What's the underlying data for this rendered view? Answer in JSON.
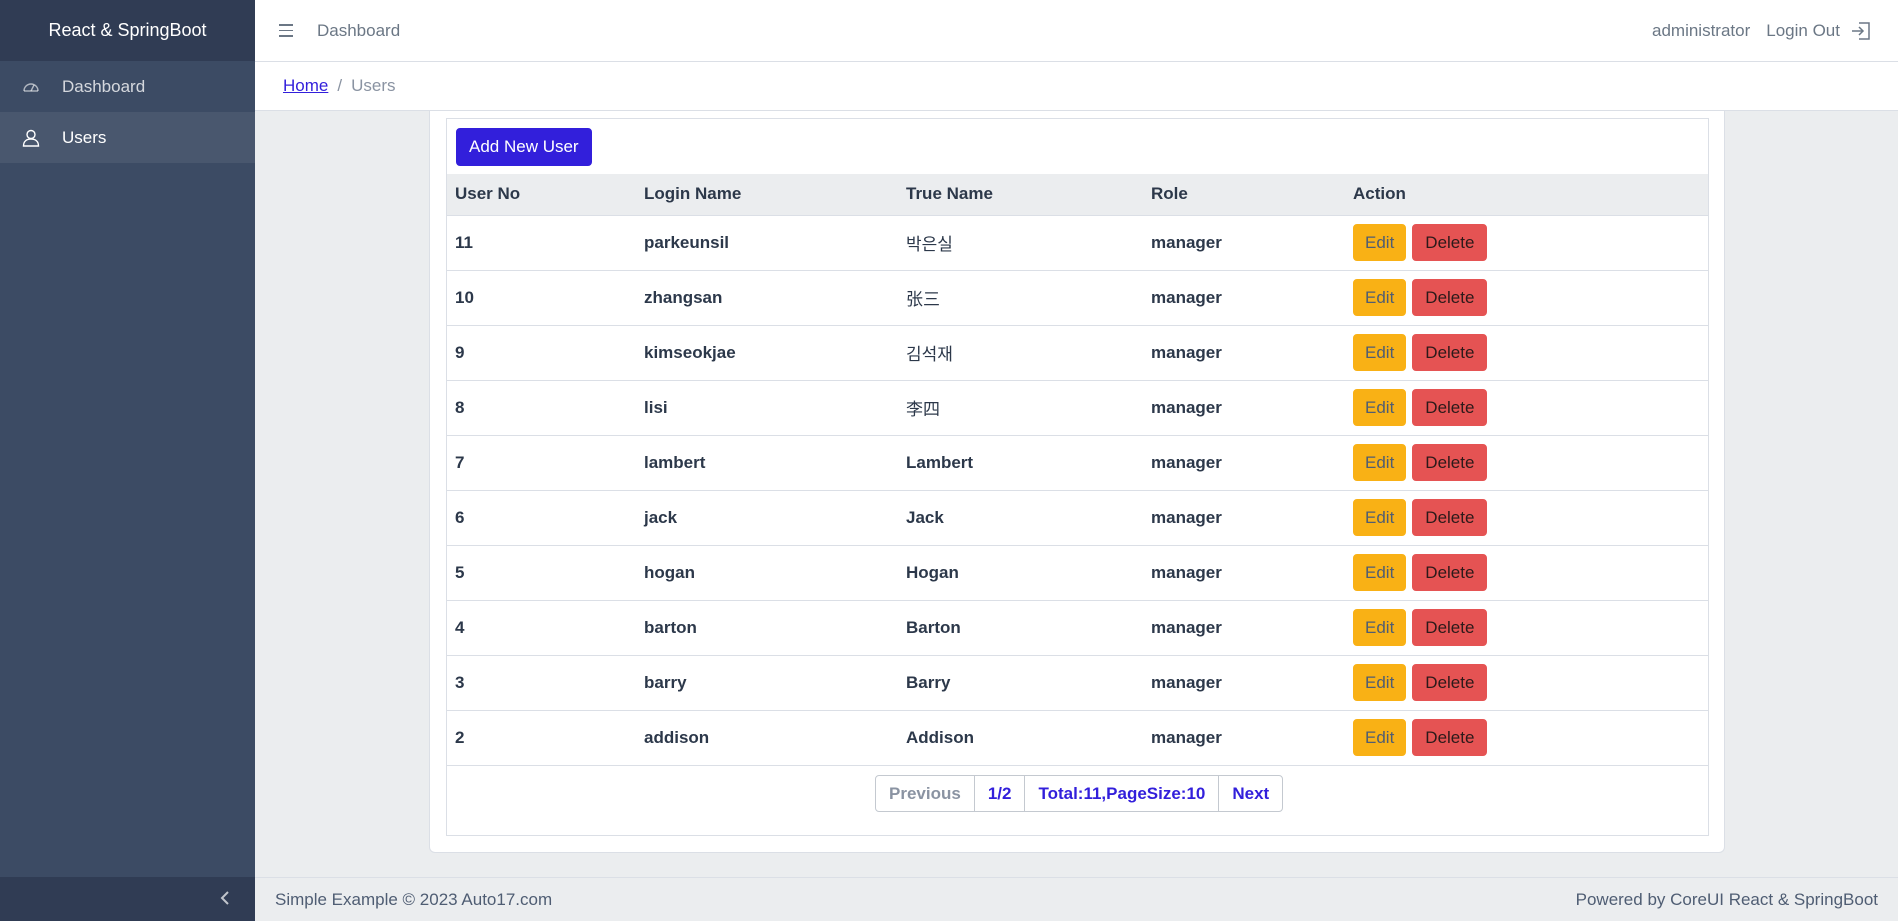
{
  "sidebar": {
    "brand": "React & SpringBoot",
    "items": [
      {
        "label": "Dashboard",
        "icon": "speedometer-icon"
      },
      {
        "label": "Users",
        "icon": "user-icon"
      }
    ],
    "toggler_icon": "chevron-left-icon"
  },
  "header": {
    "title": "Dashboard",
    "user": "administrator",
    "logout_label": "Login Out"
  },
  "breadcrumb": {
    "home": "Home",
    "separator": "/",
    "current": "Users"
  },
  "main": {
    "add_button": "Add New User",
    "columns": [
      "User No",
      "Login Name",
      "True Name",
      "Role",
      "Action"
    ],
    "rows": [
      {
        "no": "11",
        "login": "parkeunsil",
        "name": "박은실",
        "role": "manager"
      },
      {
        "no": "10",
        "login": "zhangsan",
        "name": "张三",
        "role": "manager"
      },
      {
        "no": "9",
        "login": "kimseokjae",
        "name": "김석재",
        "role": "manager"
      },
      {
        "no": "8",
        "login": "lisi",
        "name": "李四",
        "role": "manager"
      },
      {
        "no": "7",
        "login": "lambert",
        "name": "Lambert",
        "role": "manager"
      },
      {
        "no": "6",
        "login": "jack",
        "name": "Jack",
        "role": "manager"
      },
      {
        "no": "5",
        "login": "hogan",
        "name": "Hogan",
        "role": "manager"
      },
      {
        "no": "4",
        "login": "barton",
        "name": "Barton",
        "role": "manager"
      },
      {
        "no": "3",
        "login": "barry",
        "name": "Barry",
        "role": "manager"
      },
      {
        "no": "2",
        "login": "addison",
        "name": "Addison",
        "role": "manager"
      }
    ],
    "edit_label": "Edit",
    "delete_label": "Delete"
  },
  "pagination": {
    "previous": "Previous",
    "page": "1/2",
    "info": "Total:11,PageSize:10",
    "next": "Next"
  },
  "footer": {
    "left": "Simple Example © 2023 Auto17.com",
    "right": "Powered by CoreUI React & SpringBoot"
  },
  "colors": {
    "primary": "#321fdb",
    "warning": "#f9b115",
    "danger": "#e55353",
    "sidebar": "#3c4b64"
  }
}
